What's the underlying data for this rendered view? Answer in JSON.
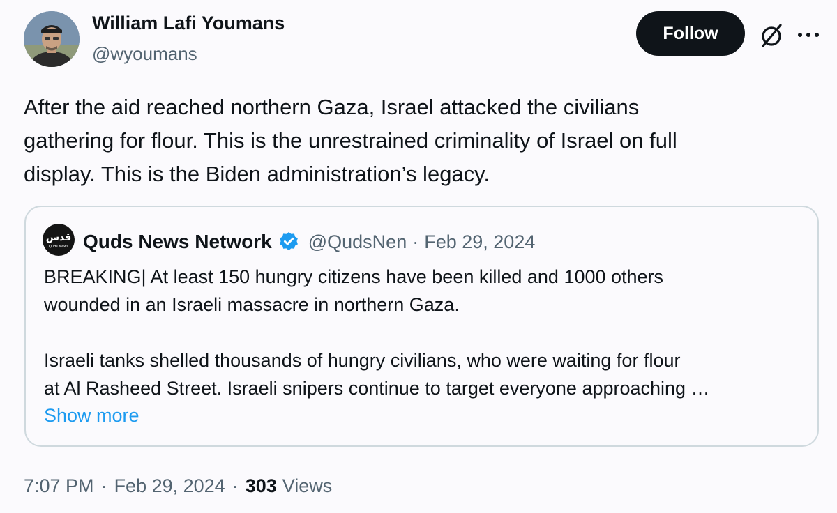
{
  "author": {
    "name": "William Lafi Youmans",
    "handle": "@wyoumans"
  },
  "actions": {
    "follow_label": "Follow"
  },
  "tweet": {
    "lines": [
      "After the aid reached northern Gaza, Israel attacked the civilians",
      "gathering for flour. This is the unrestrained criminality of Israel on full",
      "display. This is the Biden administration’s legacy."
    ]
  },
  "quote": {
    "avatar_text": "قدس",
    "avatar_subtext": "Quds News",
    "name": "Quds News Network",
    "verified": true,
    "handle": "@QudsNen",
    "separator": "·",
    "date": "Feb 29, 2024",
    "paragraph1": [
      "BREAKING| At least 150 hungry citizens have been killed and 1000 others",
      "wounded in an Israeli massacre in northern Gaza."
    ],
    "paragraph2": [
      "Israeli tanks shelled thousands of hungry civilians, who were waiting for flour",
      "at Al Rasheed Street. Israeli snipers continue to target everyone approaching …"
    ],
    "show_more": "Show more"
  },
  "meta": {
    "time": "7:07 PM",
    "separator": "·",
    "date": "Feb 29, 2024",
    "views_count": "303",
    "views_label": "Views"
  },
  "icons": {
    "grok": "grok-icon",
    "more": "more-horizontal-icon",
    "verified": "verified-badge-icon"
  },
  "colors": {
    "text_primary": "#0f1419",
    "text_secondary": "#536471",
    "link": "#1d9bf0",
    "verified": "#1d9bf0",
    "follow_bg": "#0f1419",
    "border": "#cfd9de"
  }
}
